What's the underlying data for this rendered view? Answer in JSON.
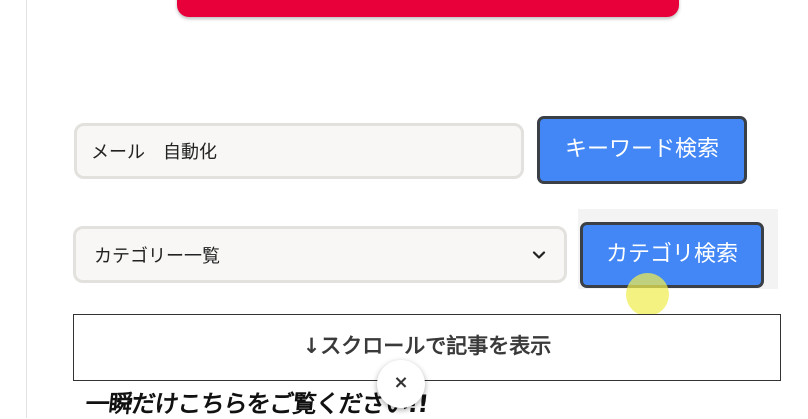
{
  "search": {
    "keyword_value": "メール　自動化",
    "keyword_button_label": "キーワード検索"
  },
  "category": {
    "selected": "カテゴリー一覧",
    "button_label": "カテゴリ検索"
  },
  "scroll_link": {
    "label": "↓スクロールで記事を表示"
  },
  "promo": {
    "text": "一瞬だけこちらをご覧ください!!"
  },
  "popup": {
    "close_label": "×"
  },
  "icons": {
    "select_arrow": "chevron-down-icon",
    "close": "close-icon"
  },
  "colors": {
    "banner_red": "#e8003a",
    "button_blue": "#4287f5",
    "button_border": "#3b3f46",
    "field_bg": "#f8f7f5"
  }
}
